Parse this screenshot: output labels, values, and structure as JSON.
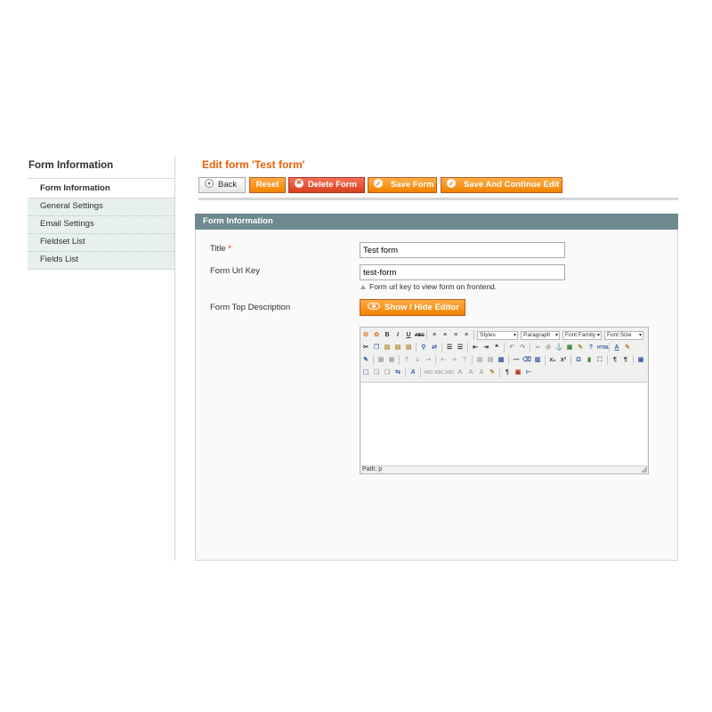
{
  "sidebar": {
    "title": "Form Information",
    "items": [
      {
        "label": "Form Information",
        "active": true
      },
      {
        "label": "General Settings"
      },
      {
        "label": "Email Settings"
      },
      {
        "label": "Fieldset List"
      },
      {
        "label": "Fields List"
      }
    ]
  },
  "header": {
    "title": "Edit form 'Test form'",
    "buttons": {
      "back": "Back",
      "reset": "Reset",
      "delete": "Delete Form",
      "save": "Save Form",
      "save_continue": "Save And Continue Edit"
    }
  },
  "fieldset": {
    "title": "Form Information",
    "title_field": {
      "label": "Title",
      "required": "*",
      "value": "Test form"
    },
    "url_key": {
      "label": "Form Url Key",
      "value": "test-form",
      "note": "Form url key to view  form on frontend."
    },
    "description": {
      "label": "Form Top Description",
      "toggle_button": "Show / Hide Editor"
    }
  },
  "editor": {
    "selects": {
      "styles": "Styles",
      "format": "Paragraph",
      "font_family": "Font Family",
      "font_size": "Font Size"
    },
    "path_label": "Path: p",
    "bold": "B",
    "italic": "I",
    "underline": "U",
    "strike": "ABC",
    "omega": "Ω",
    "subscript": "x₂",
    "superscript": "x²",
    "colors": {
      "accent": "#eb5e00",
      "button": "#f18200",
      "fieldset_header": "#6f8992",
      "sidebar_item": "#e7efef"
    }
  }
}
